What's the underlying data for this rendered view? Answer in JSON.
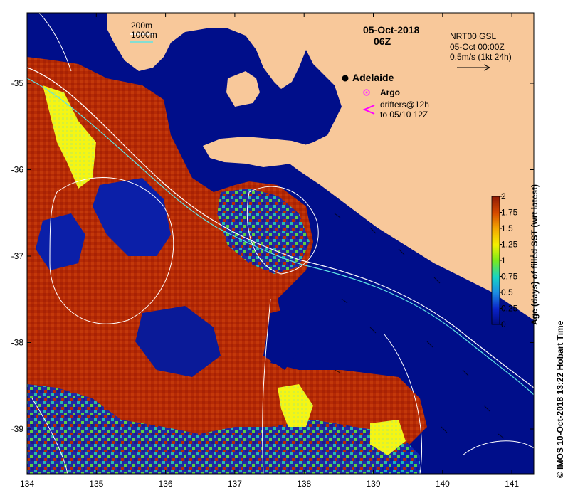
{
  "map": {
    "date": "05-Oct-2018",
    "hour": "06Z",
    "xaxis_ticks": [
      "134",
      "135",
      "136",
      "137",
      "138",
      "139",
      "140",
      "141"
    ],
    "yaxis_ticks": [
      "-35",
      "-36",
      "-37",
      "-38",
      "-39"
    ],
    "colors": {
      "land": "#F8C89A",
      "ocean": "#000E8A",
      "old_sst": "#B52A05",
      "mid_red": "#C43A02",
      "fresh_sst": "#15C8C0",
      "yellow": "#F5F514"
    }
  },
  "isobath_legend": {
    "line_200": "200m",
    "line_1000": "1000m",
    "color_200": "#ffffff",
    "color_1000": "#5FE5E5"
  },
  "current_legend": {
    "title": "NRT00 GSL",
    "time": "05-Oct 00:00Z",
    "scale": "0.5m/s (1kt 24h)"
  },
  "places": {
    "city": "Adelaide"
  },
  "point_legend": {
    "argo": "Argo",
    "drifters_line1": "drifters@12h",
    "drifters_line2": "to 05/10 12Z",
    "argo_color": "#FF33FF",
    "drifter_color": "#FF00FF"
  },
  "colorbar": {
    "title": "Age (days) of filled SST (wrt latest)",
    "ticks": [
      "2",
      "1.75",
      "1.5",
      "1.25",
      "1",
      "0.75",
      "0.5",
      "0.25",
      "0"
    ],
    "range": [
      0,
      2
    ]
  },
  "credit": "© IMOS 10-Oct-2018 13:22 Hobart Time"
}
